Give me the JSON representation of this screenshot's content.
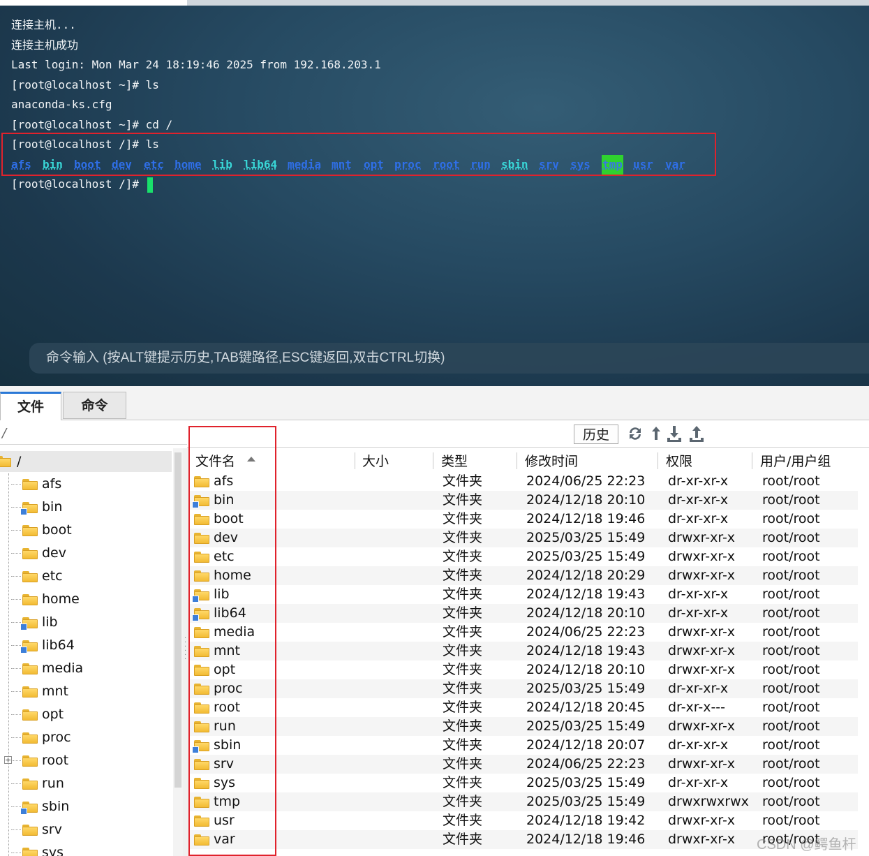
{
  "terminal": {
    "lines": [
      "连接主机...",
      "连接主机成功",
      "Last login: Mon Mar 24 18:19:46 2025 from 192.168.203.1",
      "[root@localhost ~]# ls",
      "anaconda-ks.cfg",
      "[root@localhost ~]# cd /",
      "[root@localhost /]# ls"
    ],
    "ls_output": [
      "afs",
      "bin",
      "boot",
      "dev",
      "etc",
      "home",
      "lib",
      "lib64",
      "media",
      "mnt",
      "opt",
      "proc",
      "root",
      "run",
      "sbin",
      "srv",
      "sys",
      "tmp",
      "usr",
      "var"
    ],
    "prompt": "[root@localhost /]#",
    "command_input_placeholder": "命令输入 (按ALT键提示历史,TAB键路径,ESC键返回,双击CTRL切换)"
  },
  "tabs": [
    {
      "label": "文件",
      "active": true
    },
    {
      "label": "命令",
      "active": false
    }
  ],
  "pathbar": {
    "path": "/",
    "history_label": "历史",
    "icons": [
      "refresh-icon",
      "up-arrow-icon",
      "download-icon",
      "upload-icon"
    ]
  },
  "tree": {
    "root_label": "/",
    "items": [
      "afs",
      "bin",
      "boot",
      "dev",
      "etc",
      "home",
      "lib",
      "lib64",
      "media",
      "mnt",
      "opt",
      "proc",
      "root",
      "run",
      "sbin",
      "srv",
      "sys"
    ]
  },
  "table": {
    "columns": [
      "文件名",
      "大小",
      "类型",
      "修改时间",
      "权限",
      "用户/用户组"
    ],
    "rows": [
      {
        "name": "afs",
        "size": "",
        "type": "文件夹",
        "mtime": "2024/06/25 22:23",
        "perm": "dr-xr-xr-x",
        "owner": "root/root"
      },
      {
        "name": "bin",
        "size": "",
        "type": "文件夹",
        "mtime": "2024/12/18 20:10",
        "perm": "dr-xr-xr-x",
        "owner": "root/root"
      },
      {
        "name": "boot",
        "size": "",
        "type": "文件夹",
        "mtime": "2024/12/18 19:46",
        "perm": "dr-xr-xr-x",
        "owner": "root/root"
      },
      {
        "name": "dev",
        "size": "",
        "type": "文件夹",
        "mtime": "2025/03/25 15:49",
        "perm": "drwxr-xr-x",
        "owner": "root/root"
      },
      {
        "name": "etc",
        "size": "",
        "type": "文件夹",
        "mtime": "2025/03/25 15:49",
        "perm": "drwxr-xr-x",
        "owner": "root/root"
      },
      {
        "name": "home",
        "size": "",
        "type": "文件夹",
        "mtime": "2024/12/18 20:29",
        "perm": "drwxr-xr-x",
        "owner": "root/root"
      },
      {
        "name": "lib",
        "size": "",
        "type": "文件夹",
        "mtime": "2024/12/18 19:43",
        "perm": "dr-xr-xr-x",
        "owner": "root/root"
      },
      {
        "name": "lib64",
        "size": "",
        "type": "文件夹",
        "mtime": "2024/12/18 20:10",
        "perm": "dr-xr-xr-x",
        "owner": "root/root"
      },
      {
        "name": "media",
        "size": "",
        "type": "文件夹",
        "mtime": "2024/06/25 22:23",
        "perm": "drwxr-xr-x",
        "owner": "root/root"
      },
      {
        "name": "mnt",
        "size": "",
        "type": "文件夹",
        "mtime": "2024/12/18 19:43",
        "perm": "drwxr-xr-x",
        "owner": "root/root"
      },
      {
        "name": "opt",
        "size": "",
        "type": "文件夹",
        "mtime": "2024/12/18 20:10",
        "perm": "drwxr-xr-x",
        "owner": "root/root"
      },
      {
        "name": "proc",
        "size": "",
        "type": "文件夹",
        "mtime": "2025/03/25 15:49",
        "perm": "dr-xr-xr-x",
        "owner": "root/root"
      },
      {
        "name": "root",
        "size": "",
        "type": "文件夹",
        "mtime": "2024/12/18 20:45",
        "perm": "dr-xr-x---",
        "owner": "root/root"
      },
      {
        "name": "run",
        "size": "",
        "type": "文件夹",
        "mtime": "2025/03/25 15:49",
        "perm": "drwxr-xr-x",
        "owner": "root/root"
      },
      {
        "name": "sbin",
        "size": "",
        "type": "文件夹",
        "mtime": "2024/12/18 20:07",
        "perm": "dr-xr-xr-x",
        "owner": "root/root"
      },
      {
        "name": "srv",
        "size": "",
        "type": "文件夹",
        "mtime": "2024/06/25 22:23",
        "perm": "drwxr-xr-x",
        "owner": "root/root"
      },
      {
        "name": "sys",
        "size": "",
        "type": "文件夹",
        "mtime": "2025/03/25 15:49",
        "perm": "dr-xr-xr-x",
        "owner": "root/root"
      },
      {
        "name": "tmp",
        "size": "",
        "type": "文件夹",
        "mtime": "2025/03/25 15:49",
        "perm": "drwxrwxrwx",
        "owner": "root/root"
      },
      {
        "name": "usr",
        "size": "",
        "type": "文件夹",
        "mtime": "2024/12/18 19:42",
        "perm": "drwxr-xr-x",
        "owner": "root/root"
      },
      {
        "name": "var",
        "size": "",
        "type": "文件夹",
        "mtime": "2024/12/18 19:46",
        "perm": "drwxr-xr-x",
        "owner": "root/root"
      }
    ]
  },
  "watermark": "CSDN @鳄鱼杆",
  "colors": {
    "highlight_red": "#e0222c",
    "ls_dir_blue": "#2f6fe8",
    "ls_link_cyan": "#39d7d7",
    "tmp_bg_green": "#2fd22f",
    "cursor_green": "#19e06b",
    "tab_accent": "#2a78d6"
  }
}
